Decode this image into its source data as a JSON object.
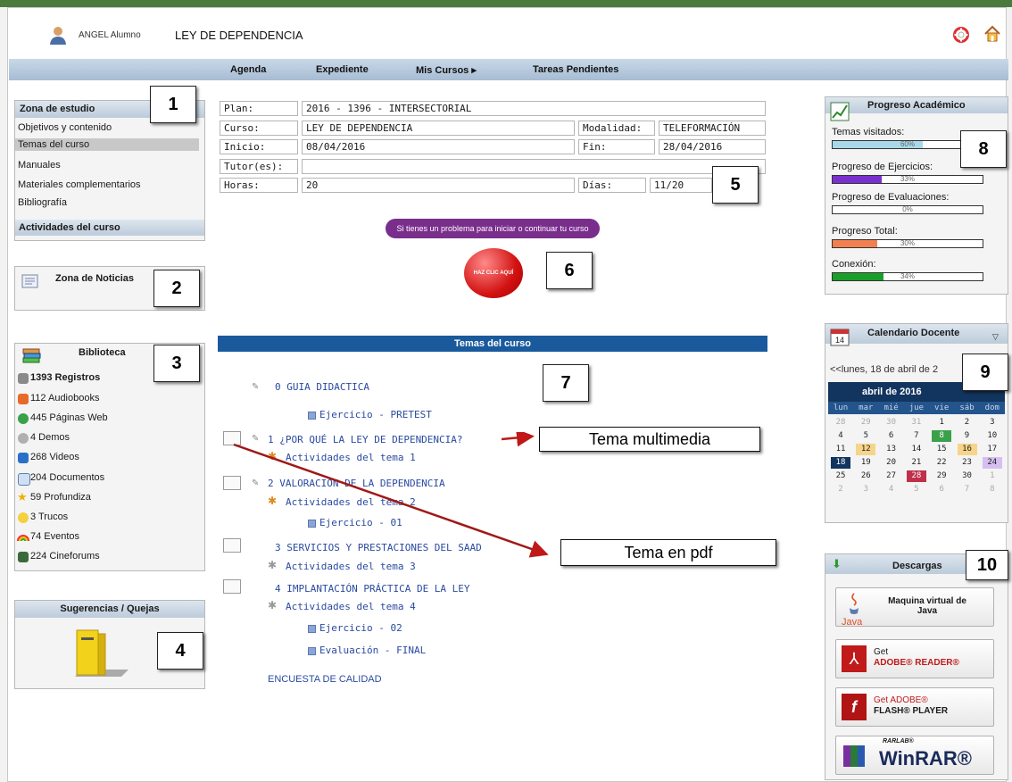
{
  "header": {
    "user_name": "ANGEL  Alumno",
    "course_title": "LEY DE DEPENDENCIA"
  },
  "nav": [
    "Agenda",
    "Expediente",
    "Mis Cursos ▸",
    "Tareas Pendientes"
  ],
  "zona_estudio": {
    "title": "Zona de estudio",
    "links": [
      "Objetivos y contenido",
      "Temas del curso",
      "Manuales",
      "Materiales complementarios",
      "Bibliografía"
    ],
    "footer": "Actividades del curso"
  },
  "noticias": {
    "title": "Zona de Noticias"
  },
  "biblioteca": {
    "title": "Biblioteca",
    "items": [
      "1393 Registros",
      "112 Audiobooks",
      "445 Páginas Web",
      "4 Demos",
      "268 Videos",
      "204 Documentos",
      "59 Profundiza",
      "3 Trucos",
      "74 Eventos",
      "224 Cineforums"
    ]
  },
  "sugerencias": {
    "title": "Sugerencias / Quejas"
  },
  "course_info": {
    "plan_label": "Plan:",
    "plan_value": "2016 - 1396 - INTERSECTORIAL",
    "curso_label": "Curso:",
    "curso_value": "LEY DE DEPENDENCIA",
    "modalidad_label": "Modalidad:",
    "modalidad_value": "TELEFORMACIÓN",
    "inicio_label": "Inicio:",
    "inicio_value": "08/04/2016",
    "fin_label": "Fin:",
    "fin_value": "28/04/2016",
    "tutor_label": "Tutor(es):",
    "tutor_value": "",
    "horas_label": "Horas:",
    "horas_value": "20",
    "dias_label": "Días:",
    "dias_value": "11/20"
  },
  "help_button": "Si tienes un problema para iniciar o continuar tu curso",
  "click_button": "HAZ CLIC AQUÍ",
  "temas": {
    "title": "Temas del curso",
    "t0": "0 GUIA DIDACTICA",
    "t0_ex": "Ejercicio - PRETEST",
    "t1": "1 ¿POR QUÉ LA LEY DE DEPENDENCIA?",
    "t1_act": "Actividades del tema 1",
    "t2": "2 VALORACIÓN DE LA DEPENDENCIA",
    "t2_act": "Actividades del tema 2",
    "t2_ex": "Ejercicio - 01",
    "t3": "3 SERVICIOS Y PRESTACIONES DEL SAAD",
    "t3_act": "Actividades del tema 3",
    "t4": "4 IMPLANTACIÓN PRÁCTICA DE LA LEY",
    "t4_act": "Actividades del tema 4",
    "t4_ex": "Ejercicio - 02",
    "t4_eval": "Evaluación - FINAL",
    "encuesta": "ENCUESTA DE CALIDAD"
  },
  "callouts": {
    "multimedia": "Tema multimedia",
    "pdf": "Tema en pdf",
    "n1": "1",
    "n2": "2",
    "n3": "3",
    "n4": "4",
    "n5": "5",
    "n6": "6",
    "n7": "7",
    "n8": "8",
    "n9": "9",
    "n10": "10"
  },
  "progreso": {
    "title": "Progreso Académico",
    "bars": [
      {
        "label": "Temas visitados:",
        "text": "60%",
        "fraction": 0.6,
        "color": "#a8d8ea"
      },
      {
        "label": "Progreso de Ejercicios:",
        "text": "33%",
        "fraction": 0.33,
        "color": "#7a2fd0"
      },
      {
        "label": "Progreso de Evaluaciones:",
        "text": "0%",
        "fraction": 0.0,
        "color": "#888888"
      },
      {
        "label": "Progreso Total:",
        "text": "30%",
        "fraction": 0.3,
        "color": "#f08050"
      },
      {
        "label": "Conexión:",
        "text": "34%",
        "fraction": 0.34,
        "color": "#1aa02a"
      }
    ]
  },
  "calendario": {
    "title": "Calendario Docente",
    "icon_day": "14",
    "nav_text": "<<lunes, 18 de abril de 2",
    "month": "abril de 2016",
    "weekdays": [
      "lun",
      "mar",
      "mié",
      "jue",
      "vie",
      "sáb",
      "dom"
    ],
    "weeks": [
      [
        "28",
        "29",
        "30",
        "31",
        "1",
        "2",
        "3"
      ],
      [
        "4",
        "5",
        "6",
        "7",
        "8",
        "9",
        "10"
      ],
      [
        "11",
        "12",
        "13",
        "14",
        "15",
        "16",
        "17"
      ],
      [
        "18",
        "19",
        "20",
        "21",
        "22",
        "23",
        "24"
      ],
      [
        "25",
        "26",
        "27",
        "28",
        "29",
        "30",
        "1"
      ],
      [
        "2",
        "3",
        "4",
        "5",
        "6",
        "7",
        "8"
      ]
    ]
  },
  "descargas": {
    "title": "Descargas",
    "java": "Maquina virtual de Java",
    "java_brand": "Java",
    "adobe_get": "Get",
    "adobe_reader": "ADOBE® READER®",
    "flash_get": "Get ADOBE®",
    "flash_player": "FLASH® PLAYER",
    "winrar_brand": "RARLAB®",
    "winrar": "WinRAR®"
  }
}
